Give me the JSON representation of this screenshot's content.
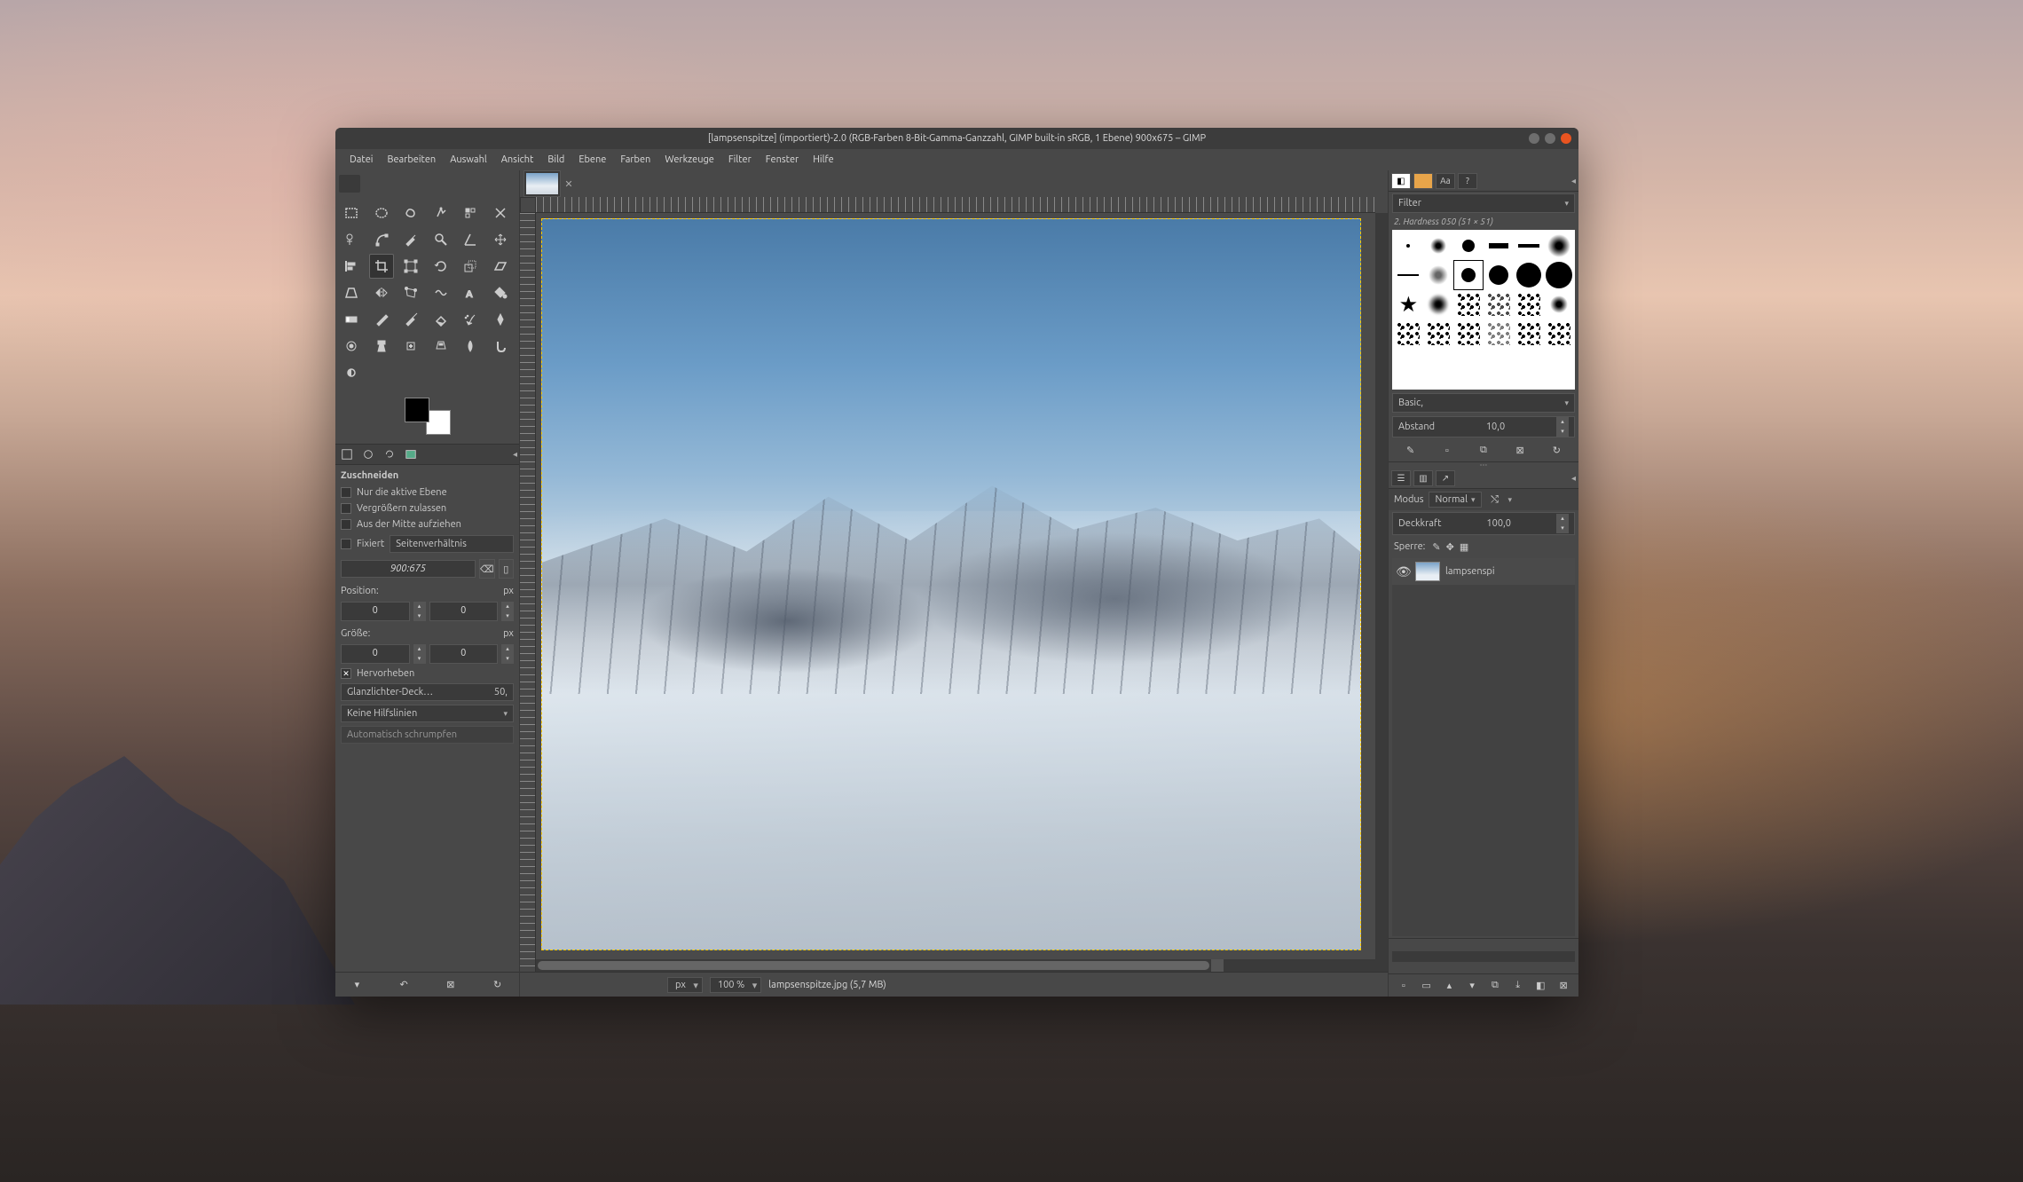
{
  "window": {
    "title": "[lampsenspitze] (importiert)-2.0 (RGB-Farben 8-Bit-Gamma-Ganzzahl, GIMP built-in sRGB, 1 Ebene) 900x675 – GIMP"
  },
  "menu": [
    "Datei",
    "Bearbeiten",
    "Auswahl",
    "Ansicht",
    "Bild",
    "Ebene",
    "Farben",
    "Werkzeuge",
    "Filter",
    "Fenster",
    "Hilfe"
  ],
  "toolOptions": {
    "title": "Zuschneiden",
    "onlyActive": "Nur die aktive Ebene",
    "allowGrow": "Vergrößern zulassen",
    "fromCenter": "Aus der Mitte aufziehen",
    "fixed": "Fixiert",
    "fixedType": "Seitenverhältnis",
    "ratio": "900:675",
    "positionLabel": "Position:",
    "positionX": "0",
    "positionY": "0",
    "sizeLabel": "Größe:",
    "sizeW": "0",
    "sizeH": "0",
    "unit": "px",
    "highlight": "Hervorheben",
    "highlightOpacityLabel": "Glanzlichter-Deck…",
    "highlightOpacityValue": "50,",
    "guides": "Keine Hilfslinien",
    "autoShrink": "Automatisch schrumpfen"
  },
  "brushes": {
    "filterLabel": "Filter",
    "currentBrush": "2. Hardness 050 (51 × 51)",
    "preset": "Basic,",
    "spacingLabel": "Abstand",
    "spacingValue": "10,0"
  },
  "layers": {
    "modeLabel": "Modus",
    "modeValue": "Normal",
    "opacityLabel": "Deckkraft",
    "opacityValue": "100,0",
    "lockLabel": "Sperre:",
    "layerName": "lampsenspi"
  },
  "status": {
    "unit": "px",
    "zoom": "100 %",
    "file": "lampsenspitze.jpg (5,7 MB)"
  }
}
